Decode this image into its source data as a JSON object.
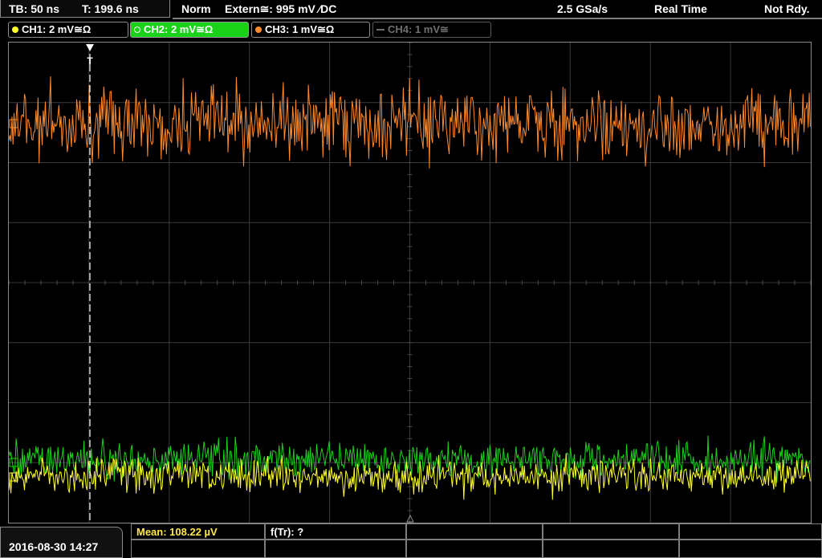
{
  "topbar": {
    "timebase": "TB: 50 ns",
    "trigger_time": "T: 199.6 ns",
    "mode": "Norm",
    "trigger_source": "Extern≅: 995 mV ∕DC",
    "sample_rate": "2.5 GSa/s",
    "acq_mode": "Real Time",
    "status": "Not Rdy."
  },
  "channels": [
    {
      "label": "CH1: 2 mV≅Ω",
      "color": "#ffff2a"
    },
    {
      "label": "CH2: 2 mV≅Ω",
      "color": "#19d219"
    },
    {
      "label": "CH3: 1 mV≅Ω",
      "color": "#ff8a2a"
    },
    {
      "label": "CH4: 1 mV≅",
      "color": "#6f6f6f"
    }
  ],
  "trigger_marker": "T",
  "bottom": {
    "datetime": "2016-08-30 14:27",
    "mean": "Mean: 108.22 µV",
    "f_tr": "f(Tr): ?"
  },
  "colors": {
    "ch1": "#ffff2a",
    "ch2": "#19d219",
    "ch3": "#ff8a2a",
    "grid": "#3a3a3a"
  }
}
